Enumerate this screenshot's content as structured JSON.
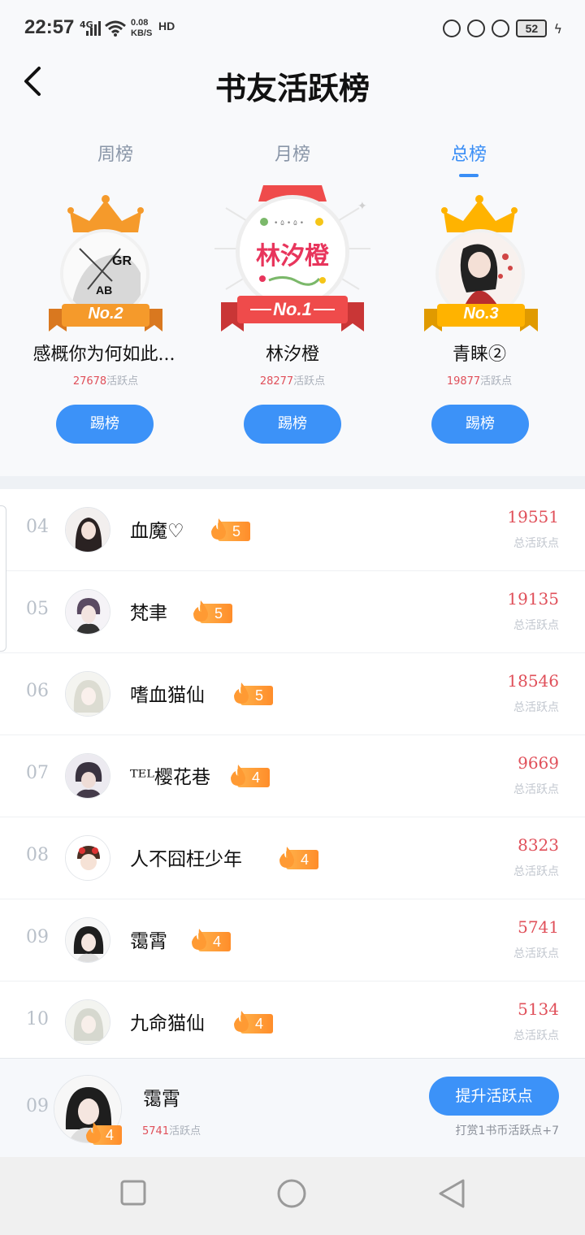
{
  "status_bar": {
    "time": "22:57",
    "network": "4G",
    "speed_value": "0.08",
    "speed_unit": "KB/S",
    "hd": "HD",
    "battery": "52"
  },
  "header": {
    "title": "书友活跃榜"
  },
  "tabs": [
    {
      "label": "周榜",
      "active": false
    },
    {
      "label": "月榜",
      "active": false
    },
    {
      "label": "总榜",
      "active": true
    }
  ],
  "podium": {
    "first": {
      "rank_label": "No.1",
      "name": "林汐橙",
      "score": "28277",
      "score_label": "活跃点",
      "button": "踢榜"
    },
    "second": {
      "rank_label": "No.2",
      "name": "感概你为何如此...",
      "score": "27678",
      "score_label": "活跃点",
      "button": "踢榜"
    },
    "third": {
      "rank_label": "No.3",
      "name": "青睐②",
      "score": "19877",
      "score_label": "活跃点",
      "button": "踢榜"
    }
  },
  "first_avatar_text": "林汐橙",
  "list": [
    {
      "rank": "04",
      "name": "血魔♡",
      "level": "5",
      "score": "19551",
      "score_label": "总活跃点"
    },
    {
      "rank": "05",
      "name": "梵聿",
      "level": "5",
      "score": "19135",
      "score_label": "总活跃点"
    },
    {
      "rank": "06",
      "name": "嗜血猫仙",
      "level": "5",
      "score": "18546",
      "score_label": "总活跃点"
    },
    {
      "rank": "07",
      "name": "ᵀᴱᴸ樱花巷",
      "level": "4",
      "score": "9669",
      "score_label": "总活跃点"
    },
    {
      "rank": "08",
      "name": "人不囧枉少年",
      "level": "4",
      "score": "8323",
      "score_label": "总活跃点"
    },
    {
      "rank": "09",
      "name": "霭霄",
      "level": "4",
      "score": "5741",
      "score_label": "总活跃点"
    },
    {
      "rank": "10",
      "name": "九命猫仙",
      "level": "4",
      "score": "5134",
      "score_label": "总活跃点"
    }
  ],
  "my_rank": {
    "rank": "09",
    "name": "霭霄",
    "level": "4",
    "score": "5741",
    "score_label": "活跃点",
    "button": "提升活跃点",
    "tip": "打赏1书币活跃点+7"
  },
  "colors": {
    "accent": "#3c92f8",
    "score_red": "#e0505a",
    "gold": "#ffb300",
    "silver_orange": "#f59a2b",
    "first_red": "#ef4b4b"
  }
}
